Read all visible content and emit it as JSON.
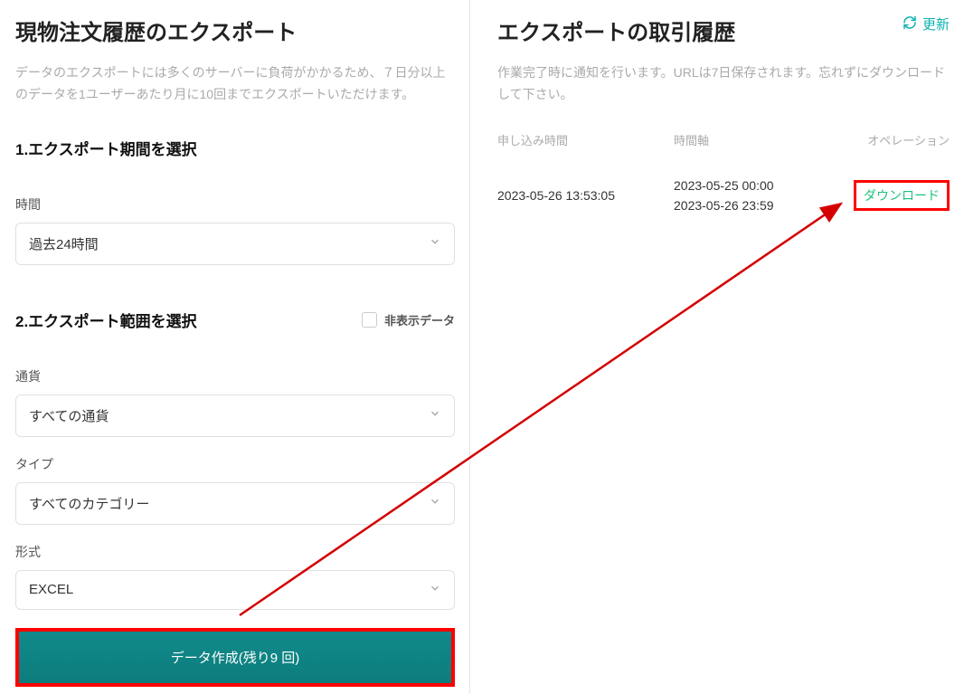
{
  "left": {
    "title": "現物注文履歴のエクスポート",
    "description": "データのエクスポートには多くのサーバーに負荷がかかるため、７日分以上のデータを1ユーザーあたり月に10回までエクスポートいただけます。",
    "section1_title": "1.エクスポート期間を選択",
    "time_label": "時間",
    "time_value": "過去24時間",
    "section2_title": "2.エクスポート範囲を選択",
    "hidden_data_label": "非表示データ",
    "currency_label": "通貨",
    "currency_value": "すべての通貨",
    "type_label": "タイプ",
    "type_value": "すべてのカテゴリー",
    "format_label": "形式",
    "format_value": "EXCEL",
    "submit_label": "データ作成(残り9 回)"
  },
  "right": {
    "title": "エクスポートの取引履歴",
    "refresh_label": "更新",
    "description": "作業完了時に通知を行います。URLは7日保存されます。忘れずにダウンロードして下さい。",
    "columns": {
      "time": "申し込み時間",
      "range": "時間軸",
      "operation": "オペレーション"
    },
    "rows": [
      {
        "time": "2023-05-26 13:53:05",
        "range_from": "2023-05-25 00:00",
        "range_to": "2023-05-26 23:59",
        "action": "ダウンロード"
      }
    ]
  }
}
